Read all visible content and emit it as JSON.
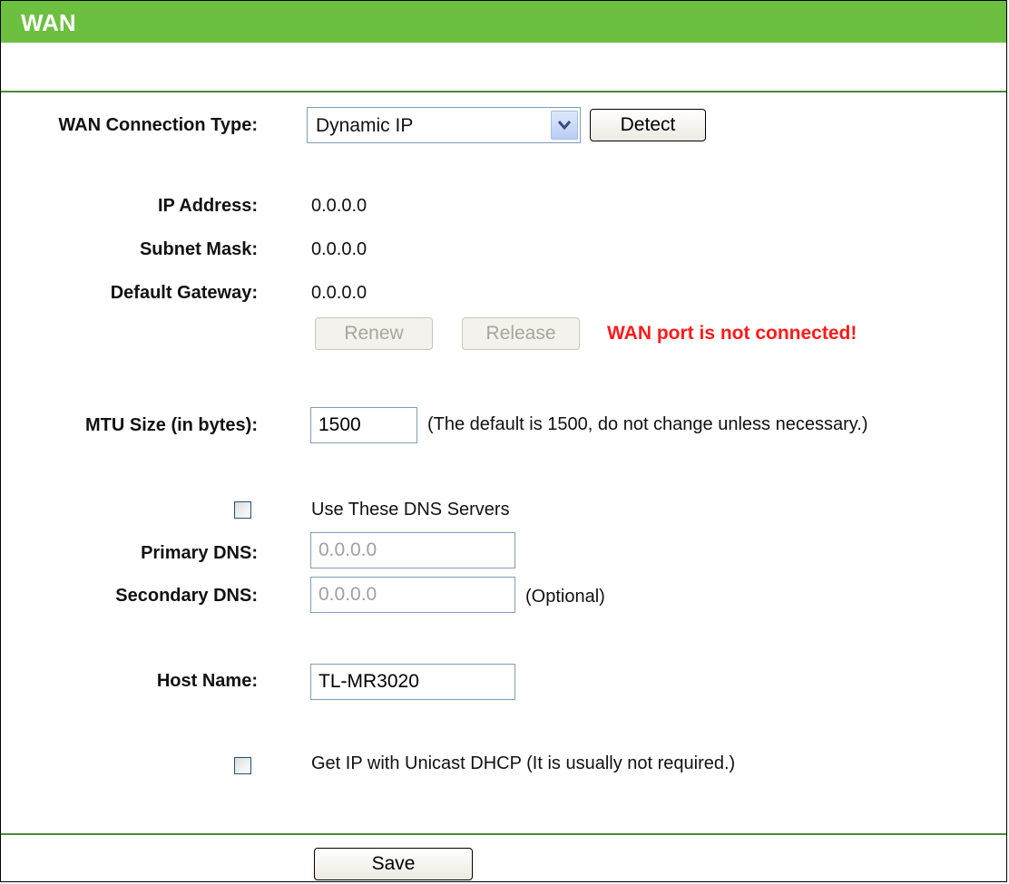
{
  "page": {
    "title": "WAN"
  },
  "wan_type": {
    "label": "WAN Connection Type:",
    "selected": "Dynamic IP",
    "detect_label": "Detect"
  },
  "ip_info": {
    "ip_label": "IP Address:",
    "ip_value": "0.0.0.0",
    "mask_label": "Subnet Mask:",
    "mask_value": "0.0.0.0",
    "gateway_label": "Default Gateway:",
    "gateway_value": "0.0.0.0",
    "renew_label": "Renew",
    "release_label": "Release",
    "status_text": "WAN port is not connected!"
  },
  "mtu": {
    "label": "MTU Size (in bytes):",
    "value": "1500",
    "hint": "(The default is 1500, do not change unless necessary.)"
  },
  "dns": {
    "use_label": "Use These DNS Servers",
    "primary_label": "Primary DNS:",
    "primary_value": "0.0.0.0",
    "secondary_label": "Secondary DNS:",
    "secondary_value": "0.0.0.0",
    "optional_text": "(Optional)"
  },
  "host": {
    "label": "Host Name:",
    "value": "TL-MR3020"
  },
  "unicast": {
    "label": "Get IP with Unicast DHCP (It is usually not required.)"
  },
  "footer": {
    "save_label": "Save"
  },
  "colors": {
    "title_bar": "#6cbf3f",
    "warning": "#ff1a1a"
  }
}
